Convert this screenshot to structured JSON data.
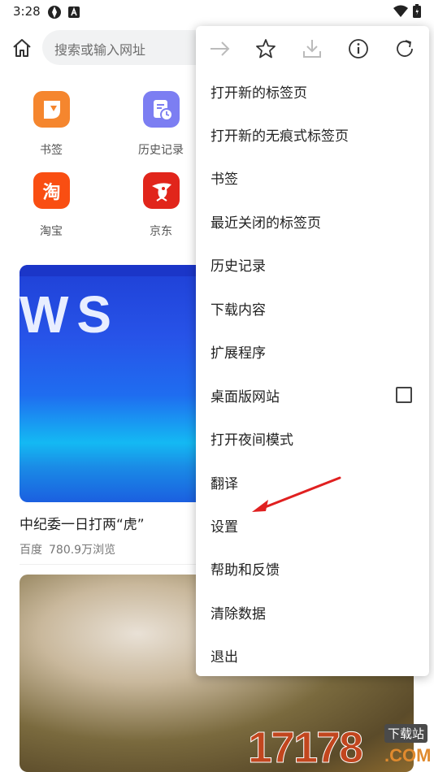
{
  "status_bar": {
    "time": "3:28"
  },
  "address_bar": {
    "placeholder": "搜索或输入网址"
  },
  "shortcuts": [
    {
      "label": "书签",
      "icon": "bookmark-app-icon",
      "color": "#f5862e"
    },
    {
      "label": "历史记录",
      "icon": "history-app-icon",
      "color": "#7c7ef2"
    },
    {
      "label": "淘宝",
      "icon": "taobao-app-icon",
      "color": "#f94e12",
      "glyph": "淘"
    },
    {
      "label": "京东",
      "icon": "jd-app-icon",
      "color": "#e1251b"
    }
  ],
  "feed": {
    "article_1": {
      "title": "中纪委一日打两“虎”",
      "source": "百度",
      "views": "780.9万浏览",
      "image_text": "WS"
    }
  },
  "menu": {
    "toolbar": [
      "forward-icon",
      "star-icon",
      "download-icon",
      "info-icon",
      "refresh-icon"
    ],
    "items": [
      {
        "label": "打开新的标签页"
      },
      {
        "label": "打开新的无痕式标签页"
      },
      {
        "label": "书签"
      },
      {
        "label": "最近关闭的标签页"
      },
      {
        "label": "历史记录"
      },
      {
        "label": "下载内容"
      },
      {
        "label": "扩展程序"
      },
      {
        "label": "桌面版网站",
        "checkbox": false
      },
      {
        "label": "打开夜间模式"
      },
      {
        "label": "翻译"
      },
      {
        "label": "设置"
      },
      {
        "label": "帮助和反馈"
      },
      {
        "label": "清除数据"
      },
      {
        "label": "退出"
      }
    ]
  },
  "watermark": {
    "number": "17178",
    "tag": "下载站",
    "domain": ".COM"
  },
  "colors": {
    "annotation_arrow": "#e02020",
    "menu_text": "#222222"
  }
}
